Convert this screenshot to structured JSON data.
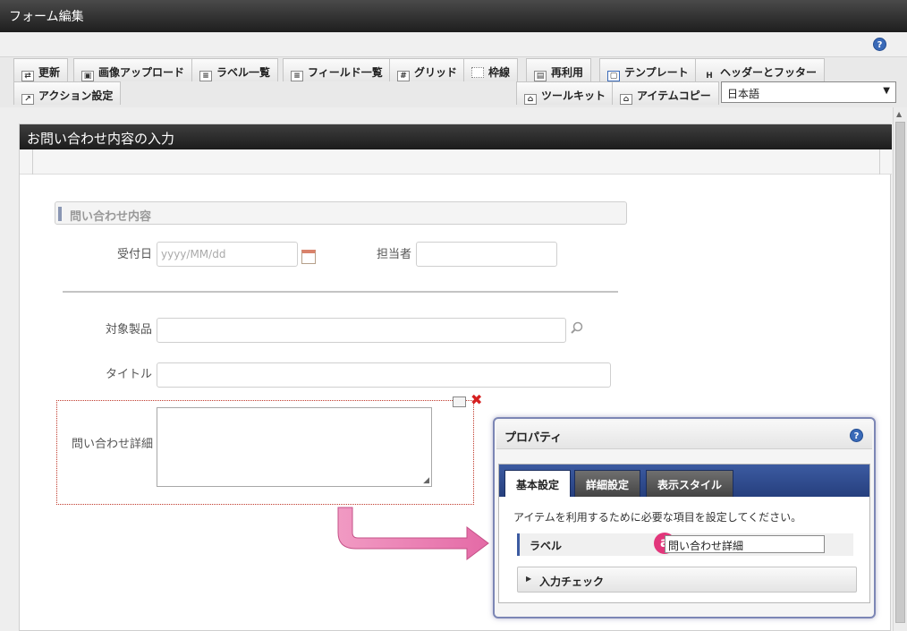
{
  "window": {
    "title": "フォーム編集"
  },
  "toolbar": {
    "row1": [
      {
        "label": "更新",
        "icon": "refresh-icon"
      },
      {
        "label": "画像アップロード",
        "icon": "image-upload-icon"
      },
      {
        "label": "ラベル一覧",
        "icon": "label-list-icon"
      },
      {
        "label": "フィールド一覧",
        "icon": "field-list-icon"
      },
      {
        "label": "グリッド",
        "icon": "grid-icon"
      },
      {
        "label": "枠線",
        "icon": "border-icon"
      },
      {
        "label": "再利用",
        "icon": "reuse-icon"
      },
      {
        "label": "テンプレート",
        "icon": "template-icon"
      },
      {
        "label": "ヘッダーとフッター",
        "icon": "header-footer-icon"
      }
    ],
    "row2": [
      {
        "label": "アクション設定",
        "icon": "action-icon"
      },
      {
        "label": "ツールキット",
        "icon": "toolkit-icon"
      },
      {
        "label": "アイテムコピー",
        "icon": "copy-item-icon"
      }
    ],
    "language": "日本語"
  },
  "form": {
    "title": "お問い合わせ内容の入力",
    "section_title": "問い合わせ内容",
    "fields": {
      "received_date_label": "受付日",
      "received_date_placeholder": "yyyy/MM/dd",
      "assignee_label": "担当者",
      "product_label": "対象製品",
      "title_label": "タイトル",
      "detail_label": "問い合わせ詳細"
    }
  },
  "properties": {
    "title": "プロパティ",
    "tabs": [
      "基本設定",
      "詳細設定",
      "表示スタイル"
    ],
    "active_tab": "基本設定",
    "description": "アイテムを利用するために必要な項目を設定してください。",
    "label_field": {
      "label": "ラベル",
      "value": "問い合わせ詳細"
    },
    "badge": "a",
    "input_check": "入力チェック"
  },
  "colors": {
    "accent_blue": "#3c5ba1",
    "badge_pink": "#e2367b",
    "selection_red": "#c0392b"
  }
}
